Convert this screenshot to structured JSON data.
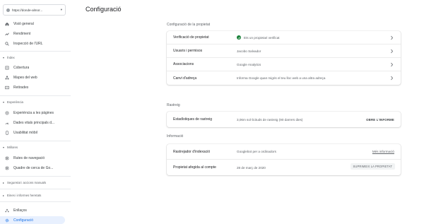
{
  "property": {
    "name": "https://donde-almor...",
    "caret": "▾"
  },
  "sidebar": {
    "top_items": [
      {
        "label": "Visió general",
        "icon": "home-icon"
      },
      {
        "label": "Rendiment",
        "icon": "trending-up-icon"
      },
      {
        "label": "Inspecció de l'URL",
        "icon": "search-icon"
      }
    ],
    "sections": [
      {
        "label": "Índex",
        "items": [
          {
            "label": "Cobertura",
            "icon": "coverage-icon"
          },
          {
            "label": "Mapes del web",
            "icon": "sitemaps-icon"
          },
          {
            "label": "Retirades",
            "icon": "removals-icon"
          }
        ]
      },
      {
        "label": "Experiència",
        "items": [
          {
            "label": "Experiència a les pàgines",
            "icon": "page-experience-icon"
          },
          {
            "label": "Dades vitals principals d...",
            "icon": "web-vitals-icon"
          },
          {
            "label": "Usabilitat mòbil",
            "icon": "mobile-icon"
          }
        ]
      },
      {
        "label": "Millores",
        "items": [
          {
            "label": "Rutes de navegació",
            "icon": "breadcrumbs-icon"
          },
          {
            "label": "Quadre de cerca de Go...",
            "icon": "sitelinks-searchbox-icon"
          }
        ]
      }
    ],
    "collapsed_sections": [
      {
        "label": "Seguretat i accions manuals"
      },
      {
        "label": "Eines i informes heretats"
      }
    ],
    "bottom_items": [
      {
        "label": "Enllaços",
        "icon": "links-icon"
      },
      {
        "label": "Configuració",
        "icon": "settings-icon"
      }
    ]
  },
  "header": {
    "title": "Configuració"
  },
  "groups": [
    {
      "label": "Configuració de la propietat",
      "rows": [
        {
          "name": "Verificació de propietat",
          "value": "Ets un propietari verificat",
          "verified": true
        },
        {
          "name": "Usuaris i permisos",
          "value": "Jacobo Salvador"
        },
        {
          "name": "Associacions",
          "value": "Google Analytics"
        },
        {
          "name": "Canvi d'adreça",
          "value": "Informa Google quan migris el teu lloc web a una altra adreça"
        }
      ]
    },
    {
      "label": "Rastreig",
      "rows": [
        {
          "name": "Estadístiques de rastreig",
          "value": "3,06m sol·licituds de rastreig (90 darrers dies)",
          "action": "OBRE L'INFORME"
        }
      ]
    },
    {
      "label": "Informació",
      "rows": [
        {
          "name": "Rastrejador d'indexació",
          "value": "Googlebot per a ordinadors",
          "action": "Més informació"
        },
        {
          "name": "Propietat afegida al compte",
          "value": "28 de març de 2020",
          "action": "SUPRIMEIX LA PROPIETAT"
        }
      ]
    }
  ],
  "colors": {
    "accent": "#1a73e8",
    "active_bg": "#e8f0fe",
    "verified": "#188038"
  }
}
